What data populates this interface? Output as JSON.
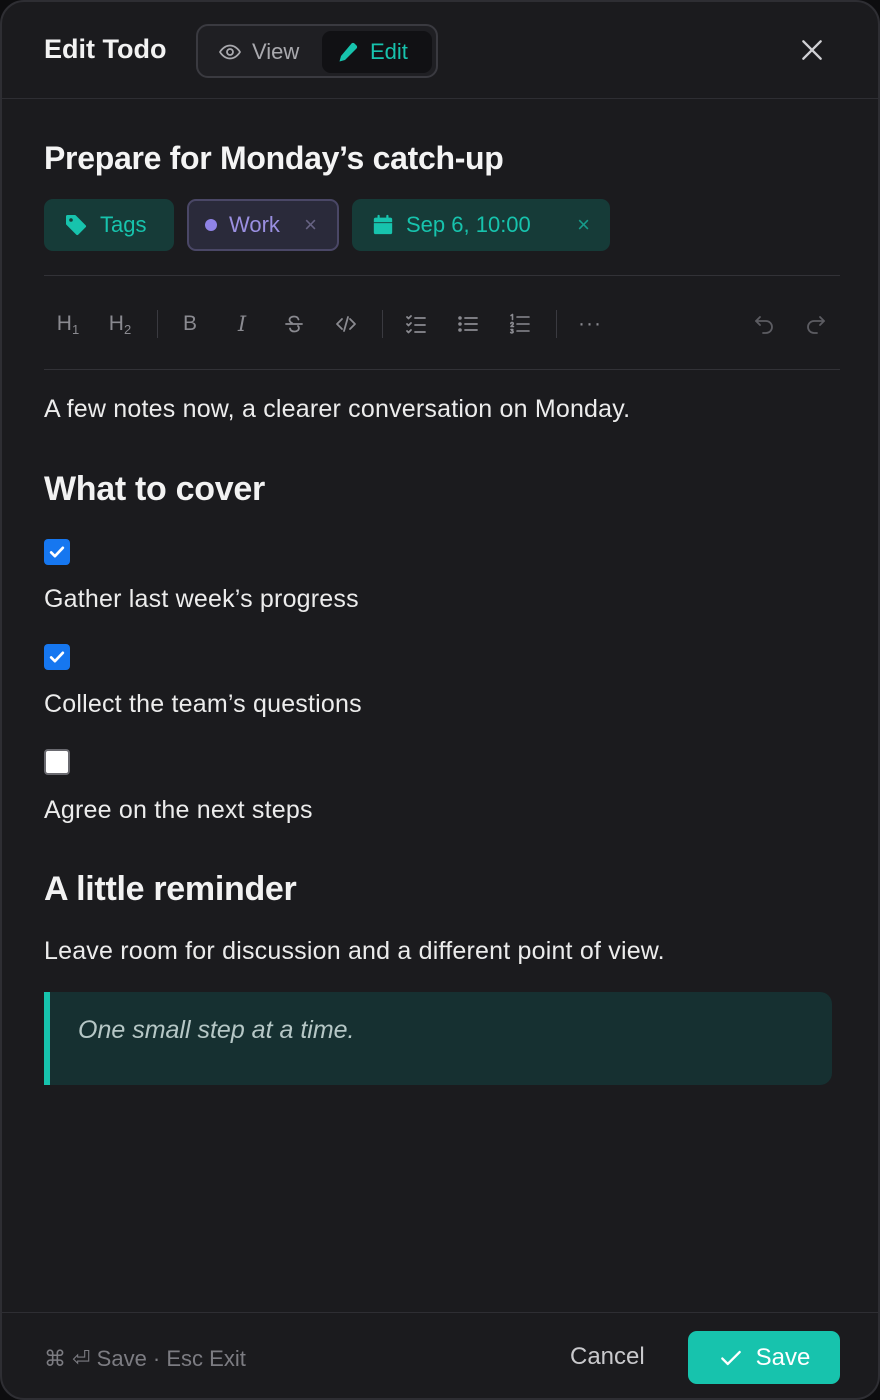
{
  "header": {
    "title": "Edit Todo",
    "view_label": "View",
    "edit_label": "Edit"
  },
  "todo": {
    "title": "Prepare for Monday’s catch-up"
  },
  "chips": {
    "tags_label": "Tags",
    "work_label": "Work",
    "date_label": "Sep 6, 10:00",
    "remove_glyph": "×"
  },
  "toolbar": {
    "h1": "H",
    "h1_sub": "1",
    "h2": "H",
    "h2_sub": "2",
    "bold": "B",
    "italic": "I",
    "more": "···"
  },
  "content": {
    "intro": "A few notes now, a clearer conversation on Monday.",
    "heading1": "What to cover",
    "tasks": [
      {
        "label": "Gather last week’s progress",
        "checked": true
      },
      {
        "label": "Collect the team’s questions",
        "checked": true
      },
      {
        "label": "Agree on the next steps",
        "checked": false
      }
    ],
    "heading2": "A little reminder",
    "paragraph": "Leave room for discussion and a different point of view.",
    "quote": "One small step at a time."
  },
  "footer": {
    "shortcut": "⌘ ⏎ Save · Esc Exit",
    "cancel_label": "Cancel",
    "save_label": "Save"
  },
  "colors": {
    "accent": "#17c3ad",
    "checkbox": "#1677f0",
    "work_tag": "#8f83e6",
    "background": "#1b1b1e"
  }
}
